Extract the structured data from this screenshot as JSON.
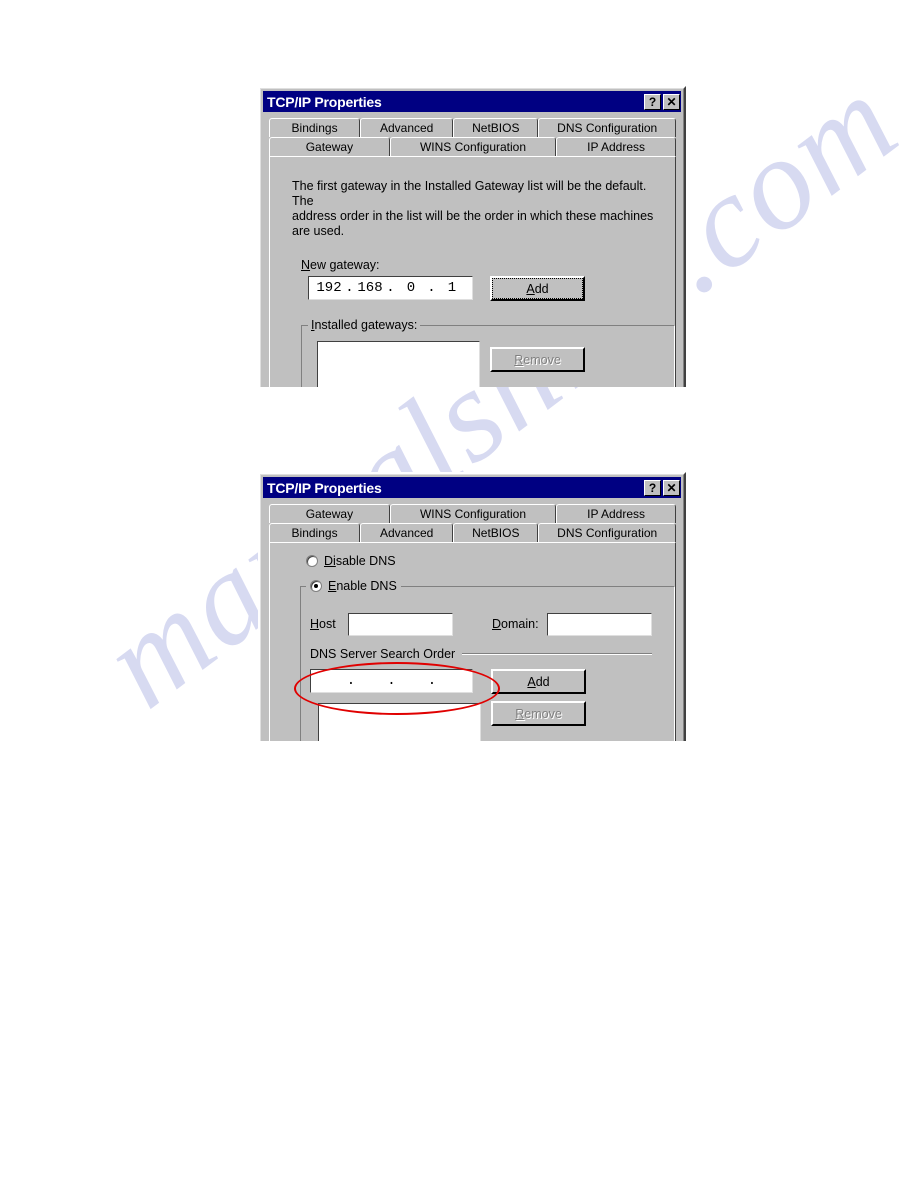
{
  "page": {
    "background_color": "#ffffff",
    "watermark_text": "manualshive.com",
    "watermark_color": "#c9cced"
  },
  "dialog_gateway": {
    "title": "TCP/IP Properties",
    "help_button": "?",
    "close_button": "✕",
    "tabs_row_top": [
      {
        "label": "Bindings",
        "active": false
      },
      {
        "label": "Advanced",
        "active": false
      },
      {
        "label": "NetBIOS",
        "active": false
      },
      {
        "label": "DNS Configuration",
        "active": false
      }
    ],
    "tabs_row_bottom": [
      {
        "label": "Gateway",
        "active": true
      },
      {
        "label": "WINS Configuration",
        "active": false
      },
      {
        "label": "IP Address",
        "active": false
      }
    ],
    "description": "The first gateway in the Installed Gateway list will be the default. The\naddress order in the list will be the order in which these machines\nare used.",
    "new_gateway_label_prefix": "N",
    "new_gateway_label_rest": "ew gateway:",
    "new_gateway_value": [
      "192",
      "168",
      "0",
      "1"
    ],
    "add_button": {
      "prefix": "A",
      "rest": "dd",
      "disabled": false,
      "focused": true
    },
    "installed_gateways_legend_prefix": "I",
    "installed_gateways_legend_rest": "nstalled gateways:",
    "installed_gateways_items": [],
    "remove_button": {
      "prefix": "R",
      "rest": "emove",
      "disabled": true,
      "focused": false
    }
  },
  "dialog_dns": {
    "title": "TCP/IP Properties",
    "help_button": "?",
    "close_button": "✕",
    "tabs_row_top": [
      {
        "label": "Gateway",
        "active": false
      },
      {
        "label": "WINS Configuration",
        "active": false
      },
      {
        "label": "IP Address",
        "active": false
      }
    ],
    "tabs_row_bottom": [
      {
        "label": "Bindings",
        "active": false
      },
      {
        "label": "Advanced",
        "active": false
      },
      {
        "label": "NetBIOS",
        "active": false
      },
      {
        "label": "DNS Configuration",
        "active": true
      }
    ],
    "disable_dns": {
      "prefix": "Di",
      "rest": "sable DNS",
      "checked": false
    },
    "enable_dns": {
      "prefix": "E",
      "rest": "nable DNS",
      "checked": true
    },
    "host_label_prefix": "H",
    "host_label_rest": "ost",
    "host_value": "",
    "domain_label_prefix": "D",
    "domain_label_rest": "omain:",
    "domain_value": "",
    "search_order_legend": "DNS Server Search Order",
    "search_order_value": [
      "",
      "",
      "",
      ""
    ],
    "add_button": {
      "prefix": "A",
      "rest": "dd",
      "disabled": false,
      "focused": false
    },
    "remove_button": {
      "prefix": "R",
      "rest": "emove",
      "disabled": true,
      "focused": false
    },
    "search_order_items": [],
    "annotation": {
      "shape": "ellipse",
      "color": "#e00000"
    }
  }
}
